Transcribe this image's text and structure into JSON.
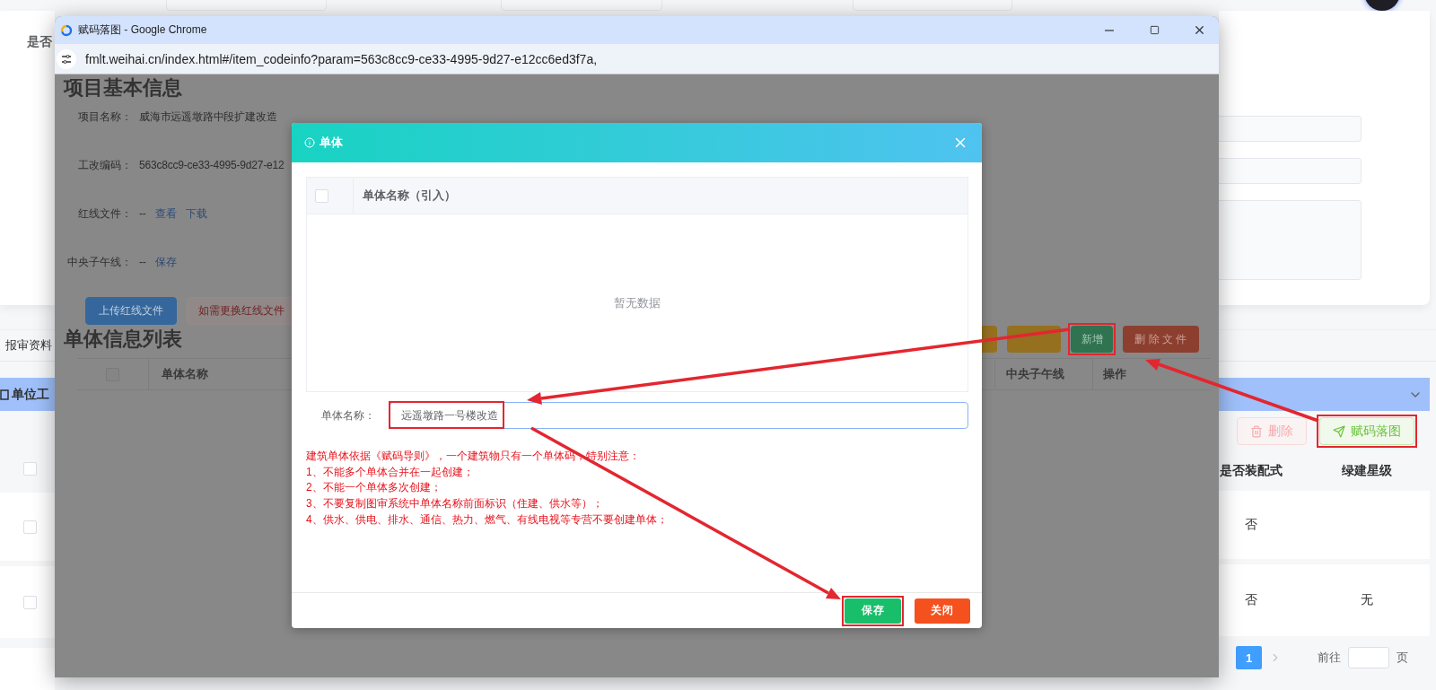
{
  "background": {
    "side_label": "是否",
    "tab_label": "报审资料",
    "section_title": "单位工",
    "actions": [
      {
        "label": "删除",
        "kind": "danger",
        "disabled": true,
        "highlighted": false
      },
      {
        "label": "赋码落图",
        "kind": "success",
        "disabled": false,
        "highlighted": true
      }
    ],
    "select_all_checked": false,
    "columns": [
      "是否装配式",
      "绿建星级"
    ],
    "rows": [
      {
        "checked": false,
        "cells": [
          "否"
        ]
      },
      {
        "checked": false,
        "cells": [
          "否",
          "无"
        ]
      }
    ],
    "pagination": {
      "pages": [
        {
          "label": "1",
          "selected": true
        }
      ],
      "goto_label": "前往",
      "page_suffix": "页"
    }
  },
  "browser": {
    "title": "赋码落图 - Google Chrome",
    "url": "fmlt.weihai.cn/index.html#/item_codeinfo?param=563c8cc9-ce33-4995-9d27-e12cc6ed3f7a,"
  },
  "page": {
    "heading": "项目基本信息",
    "fields": [
      {
        "label": "项目名称：",
        "value": "威海市远遥墩路中段扩建改造"
      },
      {
        "label": "工改编码：",
        "value": "563c8cc9-ce33-4995-9d27-e12"
      },
      {
        "label": "红线文件：",
        "value": "--",
        "links": [
          "查看",
          "下载"
        ]
      },
      {
        "label": "中央子午线：",
        "value": "--",
        "links": [
          "保存"
        ]
      }
    ],
    "buttons": [
      {
        "label": "上传红线文件",
        "kind": "primary"
      },
      {
        "label": "如需更换红线文件",
        "kind": "danger-plain"
      }
    ],
    "list_heading": "单体信息列表",
    "toolbar": [
      {
        "kind": "warning",
        "highlighted": false
      },
      {
        "kind": "warning",
        "highlighted": false
      },
      {
        "label": "新增",
        "kind": "success",
        "highlighted": true
      },
      {
        "label": "删 除 文 件",
        "kind": "danger",
        "highlighted": false
      }
    ],
    "select_all_checked": false,
    "columns": [
      "单体名称",
      "中央子午线",
      "操作"
    ]
  },
  "dialog": {
    "title": "单体",
    "select_all_checked": false,
    "columns": [
      "单体名称（引入）"
    ],
    "empty_text": "暂无数据",
    "field": {
      "label": "单体名称：",
      "value": "远遥墩路一号楼改造",
      "highlighted": true
    },
    "notes": [
      "建筑单体依据《赋码导则》，一个建筑物只有一个单体码，特别注意：",
      "1、不能多个单体合并在一起创建；",
      "2、不能一个单体多次创建；",
      "3、不要复制图审系统中单体名称前面标识（住建、供水等）；",
      "4、供水、供电、排水、通信、热力、燃气、有线电视等专营不要创建单体；"
    ],
    "buttons": [
      {
        "label": "保存",
        "kind": "success",
        "highlighted": true
      },
      {
        "label": "关闭",
        "kind": "danger",
        "highlighted": false
      }
    ]
  }
}
